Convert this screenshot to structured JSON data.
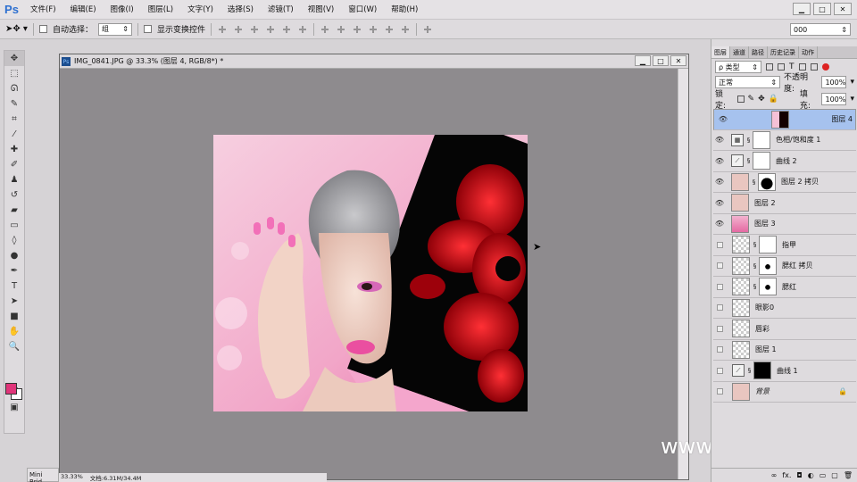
{
  "app": {
    "logo": "Ps"
  },
  "menubar": {
    "items": [
      "文件(F)",
      "编辑(E)",
      "图像(I)",
      "图层(L)",
      "文字(Y)",
      "选择(S)",
      "滤镜(T)",
      "视图(V)",
      "窗口(W)",
      "帮助(H)"
    ]
  },
  "window_controls": {
    "minimize": "▁",
    "maximize": "□",
    "close": "✕"
  },
  "options": {
    "auto_select_label": "自动选择：",
    "auto_select_value": "组",
    "show_transform_label": "显示变换控件",
    "workspace_value": "000"
  },
  "document": {
    "title": "IMG_0841.JPG @ 33.3% (图层 4, RGB/8*) *",
    "zoom": "33.33%",
    "doc_size": "文档:6.31M/34.4M"
  },
  "minibridge_label": "Mini Brid",
  "watermark": "www.hunls.com",
  "colors": {
    "foreground": "#e0357a",
    "background": "#ffffff",
    "selection": "#a6c2ee"
  },
  "panel": {
    "tabs": [
      "图层",
      "通道",
      "路径",
      "历史记录",
      "动作"
    ],
    "kind_label": "ρ 类型",
    "blend_mode": "正常",
    "opacity_label": "不透明度:",
    "opacity_value": "100%",
    "lock_label": "锁定:",
    "fill_label": "填充:",
    "fill_value": "100%",
    "layers": [
      {
        "name": "图层 4",
        "visible": true,
        "selected": true
      },
      {
        "name": "色相/饱和度 1",
        "visible": true
      },
      {
        "name": "曲线 2",
        "visible": true
      },
      {
        "name": "图层 2 拷贝",
        "visible": true
      },
      {
        "name": "图层 2",
        "visible": true
      },
      {
        "name": "图层 3",
        "visible": true
      },
      {
        "name": "指甲",
        "visible": false
      },
      {
        "name": "腮红 拷贝",
        "visible": false
      },
      {
        "name": "腮红",
        "visible": false
      },
      {
        "name": "眼影0",
        "visible": false
      },
      {
        "name": "唇彩",
        "visible": false
      },
      {
        "name": "图层 1",
        "visible": false
      },
      {
        "name": "曲线 1",
        "visible": false
      },
      {
        "name": "背景",
        "visible": false,
        "locked": true
      }
    ]
  }
}
